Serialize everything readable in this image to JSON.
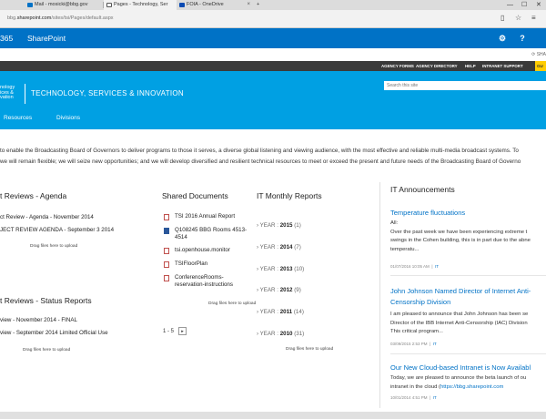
{
  "browser": {
    "tabs": [
      {
        "label": "Mail - mosicki@bbg.gov",
        "color": "#0072c6"
      },
      {
        "label": "Pages - Technology, Ser",
        "color": "#555555"
      },
      {
        "label": "FOIA - OneDrive",
        "color": "#094ab2"
      }
    ],
    "url_prefix": "bbg.",
    "url_domain": "sharepoint.com",
    "url_path": "/sites/tsi/Pages/default.aspx"
  },
  "suitebar": {
    "brand": "365",
    "app": "SharePoint",
    "settings_icon": "gear-icon",
    "help_label": "?"
  },
  "sharerow": {
    "label": "SHA"
  },
  "topnav": {
    "links": [
      "AGENCY FORMS",
      "AGENCY DIRECTORY",
      "HELP",
      "INTRANET SUPPORT"
    ],
    "yellow_label": "GU"
  },
  "header": {
    "logo_lines": [
      "nology",
      "ices &",
      "vation"
    ],
    "site_title": "TECHNOLOGY, SERVICES & INNOVATION",
    "search_placeholder": "Search this site"
  },
  "subnav": {
    "items": [
      "Resources",
      "Divisions"
    ]
  },
  "mission": {
    "line1": "to enable the Broadcasting Board of Governors to deliver programs to those it serves, a diverse global listening and viewing audience, with the most effective and reliable multi-media broadcast systems. To",
    "line2": "we will remain flexible; we will seize new opportunities; and we will develop diversified and resilient technical resources to meet or exceed the present and future needs of the Broadcasting Board of Governo"
  },
  "project_agenda": {
    "title": "t Reviews - Agenda",
    "items": [
      "ct Review - Agenda - November 2014",
      "JECT REVIEW AGENDA - September 3 2014"
    ],
    "drag": "Drag files here to upload"
  },
  "project_status": {
    "title": "t Reviews - Status Reports",
    "items": [
      "view - November 2014 - FINAL",
      "view - September 2014 Limited Official Use"
    ],
    "drag": "Drag files here to upload"
  },
  "shared_documents": {
    "title": "Shared Documents",
    "docs": [
      {
        "lines": [
          "TSI 2016 Annual Report"
        ],
        "type": "pdf"
      },
      {
        "lines": [
          "Q108245 BBG Rooms 4513-",
          "4514"
        ],
        "type": "word"
      },
      {
        "lines": [
          "tsi.openhouse.monitor"
        ],
        "type": "pdf"
      },
      {
        "lines": [
          "TSIFloorPlan"
        ],
        "type": "pdf"
      },
      {
        "lines": [
          "ConferenceRooms-",
          "reservation-instructions"
        ],
        "type": "pdf"
      }
    ],
    "drag": "Drag files here to upload",
    "pager": "1 - 5",
    "pager_next": "▸"
  },
  "monthly_reports": {
    "title": "IT Monthly Reports",
    "year_label": "YEAR :",
    "years": [
      {
        "year": "2015",
        "count": "(1)"
      },
      {
        "year": "2014",
        "count": "(7)"
      },
      {
        "year": "2013",
        "count": "(10)"
      },
      {
        "year": "2012",
        "count": "(9)"
      },
      {
        "year": "2011",
        "count": "(14)"
      },
      {
        "year": "2010",
        "count": "(31)"
      }
    ],
    "drag": "Drag files here to upload"
  },
  "announcements": {
    "title": "IT Announcements",
    "items": [
      {
        "title": "Temperature fluctuations",
        "body": [
          "All:",
          "Over the past week we have been experiencing extreme t",
          "swings in the Cohen building, this is in part due to the abne",
          "temperatu..."
        ],
        "date": "01/07/2016 10:05 AM",
        "sep": "|",
        "category": "IT"
      },
      {
        "title_lines": [
          "John Johnson Named Director of Internet Anti-",
          "Censorship Division"
        ],
        "body": [
          "I am pleased to announce that John Johnson has been se",
          "Director of the IBB Internet Anti-Censorship (IAC) Division",
          "This critical program..."
        ],
        "date": "03/09/2015 2:53 PM",
        "sep": "|",
        "category": "IT"
      },
      {
        "title": "Our New Cloud-based Intranet is Now Availabl",
        "body_line1": "Today, we are pleased to announce the beta launch of ou",
        "body_line2_prefix": "intranet in the cloud (",
        "body_link": "https://bbg.sharepoint.com",
        "date": "10/01/2014 4:51 PM",
        "sep": "|",
        "category": "IT"
      }
    ]
  },
  "colors": {
    "suite_blue": "#0072c6",
    "header_blue": "#00a0e3",
    "nav_dark": "#3a3a3a",
    "accent_yellow": "#ffcc00"
  }
}
